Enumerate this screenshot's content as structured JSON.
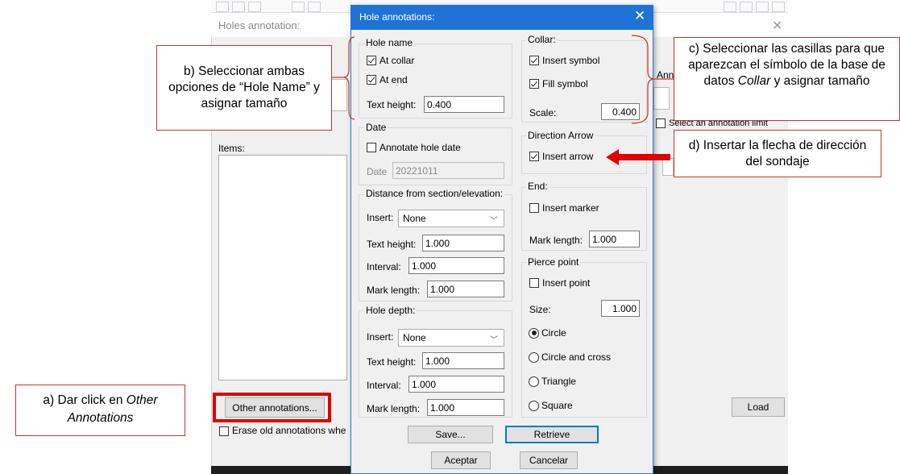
{
  "background_window": {
    "title": "Holes annotation:",
    "close_glyph": "✕",
    "items_label": "Items:",
    "other_annotations_button": "Other annotations...",
    "load_button": "Load",
    "erase_checkbox_label": "Erase old annotations whe",
    "select_limit_label": "Select an annotation limit",
    "annotate_fragment": "Ann"
  },
  "dialog": {
    "title": "Hole annotations:",
    "close_glyph": "✕",
    "hole_name": {
      "label": "Hole name",
      "at_collar": {
        "label": "At collar",
        "checked": true
      },
      "at_end": {
        "label": "At end",
        "checked": true
      },
      "text_height_label": "Text height:",
      "text_height_value": "0.400"
    },
    "collar": {
      "label": "Collar:",
      "insert_symbol": {
        "label": "Insert symbol",
        "checked": true
      },
      "fill_symbol": {
        "label": "Fill symbol",
        "checked": true
      },
      "scale_label": "Scale:",
      "scale_value": "0.400"
    },
    "date": {
      "label": "Date",
      "annotate_hole_date": {
        "label": "Annotate hole date",
        "checked": false
      },
      "date_label": "Date",
      "date_value": "20221011"
    },
    "direction_arrow": {
      "label": "Direction Arrow",
      "insert_arrow": {
        "label": "Insert arrow",
        "checked": true
      }
    },
    "distance": {
      "label": "Distance from section/elevation:",
      "insert_label": "Insert:",
      "insert_value": "None",
      "text_height_label": "Text height:",
      "text_height_value": "1.000",
      "interval_label": "Interval:",
      "interval_value": "1.000",
      "mark_length_label": "Mark length:",
      "mark_length_value": "1.000"
    },
    "end": {
      "label": "End:",
      "insert_marker": {
        "label": "Insert marker",
        "checked": false
      },
      "mark_length_label": "Mark length:",
      "mark_length_value": "1.000"
    },
    "pierce_point": {
      "label": "Pierce point",
      "insert_point": {
        "label": "Insert point",
        "checked": false
      },
      "size_label": "Size:",
      "size_value": "1.000",
      "shapes": [
        {
          "label": "Circle",
          "selected": true
        },
        {
          "label": "Circle and cross",
          "selected": false
        },
        {
          "label": "Triangle",
          "selected": false
        },
        {
          "label": "Square",
          "selected": false
        }
      ]
    },
    "hole_depth": {
      "label": "Hole depth:",
      "insert_label": "Insert:",
      "insert_value": "None",
      "text_height_label": "Text height:",
      "text_height_value": "1.000",
      "interval_label": "Interval:",
      "interval_value": "1.000",
      "mark_length_label": "Mark length:",
      "mark_length_value": "1.000"
    },
    "buttons": {
      "save": "Save...",
      "retrieve": "Retrieve",
      "accept": "Aceptar",
      "cancel": "Cancelar"
    }
  },
  "callouts": {
    "a_prefix": "a) Dar click en",
    "a_italic": "Other Annotations",
    "b": "b) Seleccionar ambas opciones de “Hole Name” y asignar tamaño",
    "c_line1": "c) Seleccionar las casillas para que aparezcan el símbolo de la base de datos",
    "c_italic": "Collar",
    "c_suffix": "y asignar tamaño",
    "d": "d) Insertar la flecha de dirección del sondaje"
  },
  "colors": {
    "title_bar": "#1f73d6",
    "highlight": "#e00000",
    "callout_border": "#c0392b"
  }
}
